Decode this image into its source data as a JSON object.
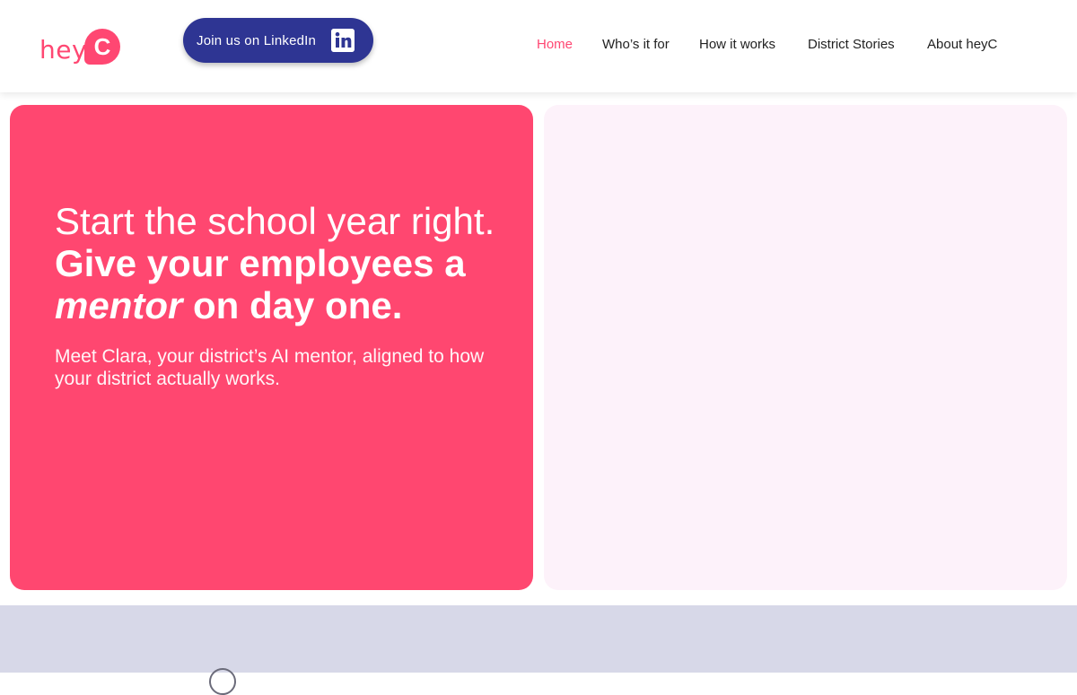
{
  "brand": {
    "logo_text": "hey",
    "logo_mark": "C",
    "color": "#ff4772"
  },
  "header": {
    "linkedin_button": {
      "label": "Join us on LinkedIn",
      "icon": "linkedin-icon",
      "color": "#2e3593"
    },
    "nav": [
      {
        "label": "Home",
        "active": true
      },
      {
        "label": "Who’s it for",
        "active": false
      },
      {
        "label": "How it works",
        "active": false
      },
      {
        "label": "District Stories",
        "active": false
      },
      {
        "label": "About heyC",
        "active": false
      }
    ]
  },
  "hero": {
    "title_line1": "Start the school year right.",
    "title_line2": "Give your employees a",
    "title_em": "mentor",
    "title_line3_rest": " on day one.",
    "subtitle": "Meet Clara, your district’s AI mentor, aligned to how your district actually works.",
    "left_bg": "#ff4770",
    "right_bg": "#fdf2fa"
  },
  "lower_band": {
    "bg": "#d7d8e8"
  }
}
